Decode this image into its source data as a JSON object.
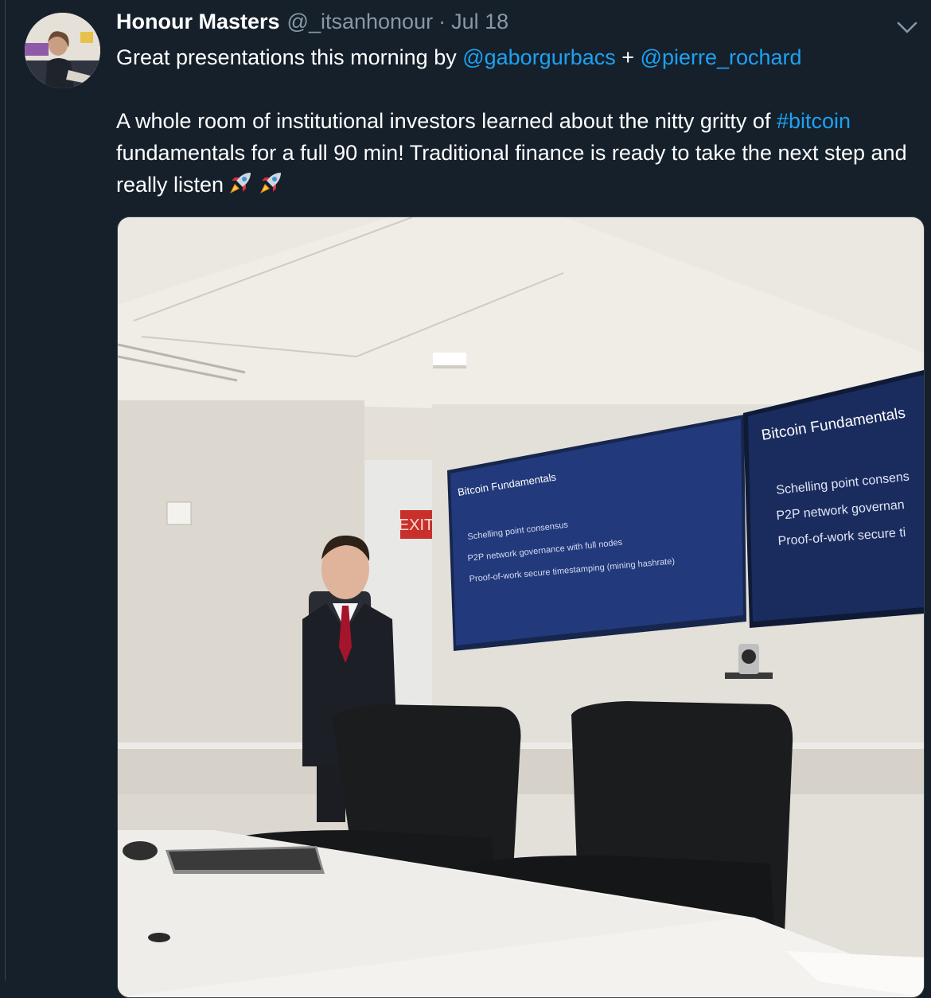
{
  "tweet": {
    "author_name": "Honour Masters",
    "handle": "@_itsanhonour",
    "separator": "·",
    "date": "Jul 18",
    "line1_pre": "Great presentations this morning by ",
    "mention1": "@gaborgurbacs",
    "line1_mid": " + ",
    "mention2": "@pierre_rochard",
    "para2_pre": "A whole room of institutional investors learned about the nitty gritty of ",
    "hashtag": "#bitcoin",
    "para2_post": " fundamentals for a full 90 min! Traditional finance is ready to take the next step and really listen",
    "emojis": [
      "rocket-icon",
      "rocket-icon"
    ]
  },
  "photo": {
    "exit_sign": "EXIT",
    "left_screen": {
      "title": "Bitcoin Fundamentals",
      "bullets": [
        "Schelling point consensus",
        "P2P network governance with full nodes",
        "Proof-of-work secure timestamping (mining hashrate)"
      ]
    },
    "right_screen": {
      "title": "Bitcoin Fundamentals",
      "bullets": [
        "Schelling point consens",
        "P2P network governan",
        "Proof-of-work secure ti"
      ]
    }
  },
  "colors": {
    "background": "#15202b",
    "link": "#1da1f2",
    "muted": "#8899a6"
  }
}
